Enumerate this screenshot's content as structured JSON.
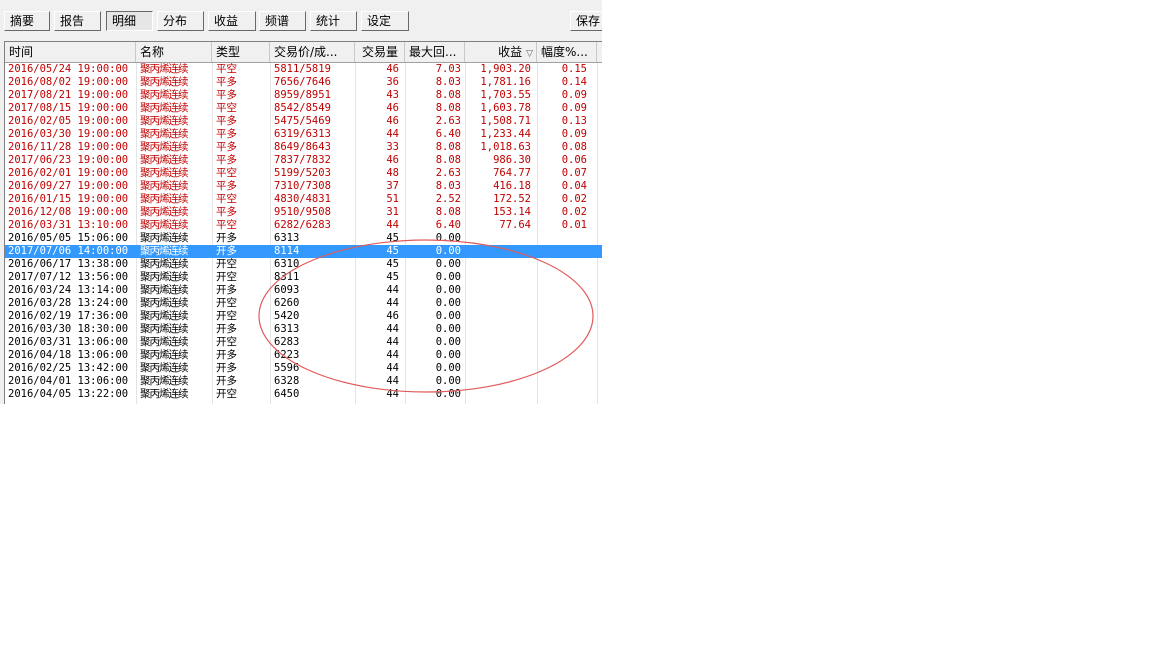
{
  "toolbar": {
    "tabs": [
      {
        "label": "摘要"
      },
      {
        "label": "报告"
      },
      {
        "label": "明细"
      },
      {
        "label": "分布"
      },
      {
        "label": "收益"
      },
      {
        "label": "频谱"
      },
      {
        "label": "统计"
      },
      {
        "label": "设定"
      }
    ],
    "active_tab": "明细",
    "save_label": "保存"
  },
  "table": {
    "columns": [
      "时间",
      "名称",
      "类型",
      "交易价/成...",
      "交易量",
      "最大回...",
      "收益",
      "幅度%..."
    ],
    "sort_indicator": "▽",
    "rows": [
      {
        "time": "2016/05/24 19:00:00",
        "name": "聚丙烯连续",
        "type": "平空",
        "price": "5811/5819",
        "qty": "46",
        "max_dd": "7.03",
        "pnl": "1,903.20",
        "pct": "0.15",
        "color": "red"
      },
      {
        "time": "2016/08/02 19:00:00",
        "name": "聚丙烯连续",
        "type": "平多",
        "price": "7656/7646",
        "qty": "36",
        "max_dd": "8.03",
        "pnl": "1,781.16",
        "pct": "0.14",
        "color": "red"
      },
      {
        "time": "2017/08/21 19:00:00",
        "name": "聚丙烯连续",
        "type": "平多",
        "price": "8959/8951",
        "qty": "43",
        "max_dd": "8.08",
        "pnl": "1,703.55",
        "pct": "0.09",
        "color": "red"
      },
      {
        "time": "2017/08/15 19:00:00",
        "name": "聚丙烯连续",
        "type": "平空",
        "price": "8542/8549",
        "qty": "46",
        "max_dd": "8.08",
        "pnl": "1,603.78",
        "pct": "0.09",
        "color": "red"
      },
      {
        "time": "2016/02/05 19:00:00",
        "name": "聚丙烯连续",
        "type": "平多",
        "price": "5475/5469",
        "qty": "46",
        "max_dd": "2.63",
        "pnl": "1,508.71",
        "pct": "0.13",
        "color": "red"
      },
      {
        "time": "2016/03/30 19:00:00",
        "name": "聚丙烯连续",
        "type": "平多",
        "price": "6319/6313",
        "qty": "44",
        "max_dd": "6.40",
        "pnl": "1,233.44",
        "pct": "0.09",
        "color": "red"
      },
      {
        "time": "2016/11/28 19:00:00",
        "name": "聚丙烯连续",
        "type": "平多",
        "price": "8649/8643",
        "qty": "33",
        "max_dd": "8.08",
        "pnl": "1,018.63",
        "pct": "0.08",
        "color": "red"
      },
      {
        "time": "2017/06/23 19:00:00",
        "name": "聚丙烯连续",
        "type": "平多",
        "price": "7837/7832",
        "qty": "46",
        "max_dd": "8.08",
        "pnl": "986.30",
        "pct": "0.06",
        "color": "red"
      },
      {
        "time": "2016/02/01 19:00:00",
        "name": "聚丙烯连续",
        "type": "平空",
        "price": "5199/5203",
        "qty": "48",
        "max_dd": "2.63",
        "pnl": "764.77",
        "pct": "0.07",
        "color": "red"
      },
      {
        "time": "2016/09/27 19:00:00",
        "name": "聚丙烯连续",
        "type": "平多",
        "price": "7310/7308",
        "qty": "37",
        "max_dd": "8.03",
        "pnl": "416.18",
        "pct": "0.04",
        "color": "red"
      },
      {
        "time": "2016/01/15 19:00:00",
        "name": "聚丙烯连续",
        "type": "平空",
        "price": "4830/4831",
        "qty": "51",
        "max_dd": "2.52",
        "pnl": "172.52",
        "pct": "0.02",
        "color": "red"
      },
      {
        "time": "2016/12/08 19:00:00",
        "name": "聚丙烯连续",
        "type": "平多",
        "price": "9510/9508",
        "qty": "31",
        "max_dd": "8.08",
        "pnl": "153.14",
        "pct": "0.02",
        "color": "red"
      },
      {
        "time": "2016/03/31 13:10:00",
        "name": "聚丙烯连续",
        "type": "平空",
        "price": "6282/6283",
        "qty": "44",
        "max_dd": "6.40",
        "pnl": "77.64",
        "pct": "0.01",
        "color": "red"
      },
      {
        "time": "2016/05/05 15:06:00",
        "name": "聚丙烯连续",
        "type": "开多",
        "price": "6313",
        "qty": "45",
        "max_dd": "0.00",
        "pnl": "",
        "pct": "",
        "color": "black"
      },
      {
        "time": "2017/07/06 14:00:00",
        "name": "聚丙烯连续",
        "type": "开多",
        "price": "8114",
        "qty": "45",
        "max_dd": "0.00",
        "pnl": "",
        "pct": "",
        "color": "black",
        "selected": true
      },
      {
        "time": "2016/06/17 13:38:00",
        "name": "聚丙烯连续",
        "type": "开空",
        "price": "6310",
        "qty": "45",
        "max_dd": "0.00",
        "pnl": "",
        "pct": "",
        "color": "black"
      },
      {
        "time": "2017/07/12 13:56:00",
        "name": "聚丙烯连续",
        "type": "开空",
        "price": "8311",
        "qty": "45",
        "max_dd": "0.00",
        "pnl": "",
        "pct": "",
        "color": "black"
      },
      {
        "time": "2016/03/24 13:14:00",
        "name": "聚丙烯连续",
        "type": "开多",
        "price": "6093",
        "qty": "44",
        "max_dd": "0.00",
        "pnl": "",
        "pct": "",
        "color": "black"
      },
      {
        "time": "2016/03/28 13:24:00",
        "name": "聚丙烯连续",
        "type": "开空",
        "price": "6260",
        "qty": "44",
        "max_dd": "0.00",
        "pnl": "",
        "pct": "",
        "color": "black"
      },
      {
        "time": "2016/02/19 17:36:00",
        "name": "聚丙烯连续",
        "type": "开空",
        "price": "5420",
        "qty": "46",
        "max_dd": "0.00",
        "pnl": "",
        "pct": "",
        "color": "black"
      },
      {
        "time": "2016/03/30 18:30:00",
        "name": "聚丙烯连续",
        "type": "开多",
        "price": "6313",
        "qty": "44",
        "max_dd": "0.00",
        "pnl": "",
        "pct": "",
        "color": "black"
      },
      {
        "time": "2016/03/31 13:06:00",
        "name": "聚丙烯连续",
        "type": "开空",
        "price": "6283",
        "qty": "44",
        "max_dd": "0.00",
        "pnl": "",
        "pct": "",
        "color": "black"
      },
      {
        "time": "2016/04/18 13:06:00",
        "name": "聚丙烯连续",
        "type": "开多",
        "price": "6223",
        "qty": "44",
        "max_dd": "0.00",
        "pnl": "",
        "pct": "",
        "color": "black"
      },
      {
        "time": "2016/02/25 13:42:00",
        "name": "聚丙烯连续",
        "type": "开多",
        "price": "5596",
        "qty": "44",
        "max_dd": "0.00",
        "pnl": "",
        "pct": "",
        "color": "black"
      },
      {
        "time": "2016/04/01 13:06:00",
        "name": "聚丙烯连续",
        "type": "开多",
        "price": "6328",
        "qty": "44",
        "max_dd": "0.00",
        "pnl": "",
        "pct": "",
        "color": "black"
      },
      {
        "time": "2016/04/05 13:22:00",
        "name": "聚丙烯连续",
        "type": "开空",
        "price": "6450",
        "qty": "44",
        "max_dd": "0.00",
        "pnl": "",
        "pct": "",
        "color": "black"
      }
    ]
  },
  "annotation": {
    "shape": "ellipse",
    "color": "#e05a5a"
  },
  "colors": {
    "profit_text": "#c00000",
    "selection": "#3399ff"
  }
}
